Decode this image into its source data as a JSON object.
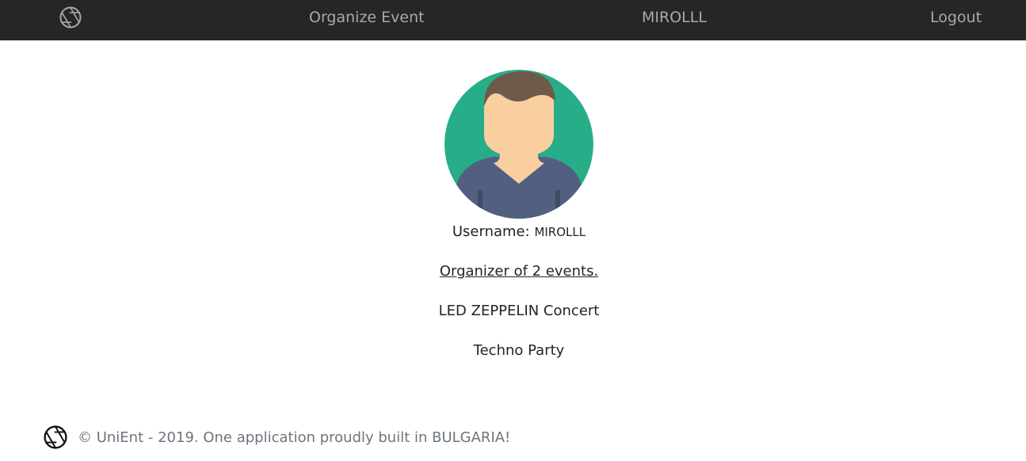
{
  "navbar": {
    "logo_icon": "aperture-icon",
    "organize_label": "Organize Event",
    "user_label": "MIROLLL",
    "logout_label": "Logout",
    "bg_color": "#262626",
    "link_color": "#a9a9a9"
  },
  "profile": {
    "avatar_icon": "user-avatar",
    "username_label": "Username:",
    "username_value": "MIROLLL",
    "organizer_text": "Organizer of 2 events.",
    "events": [
      {
        "title": "LED ZEPPELIN Concert"
      },
      {
        "title": "Techno Party"
      }
    ]
  },
  "footer": {
    "logo_icon": "aperture-icon",
    "text": "© UniEnt - 2019. One application proudly built in BULGARIA!"
  },
  "colors": {
    "avatar_bg": "#27ae89",
    "avatar_skin": "#f9cfa0",
    "avatar_hair": "#6e5a4a",
    "avatar_shirt": "#525f80"
  }
}
